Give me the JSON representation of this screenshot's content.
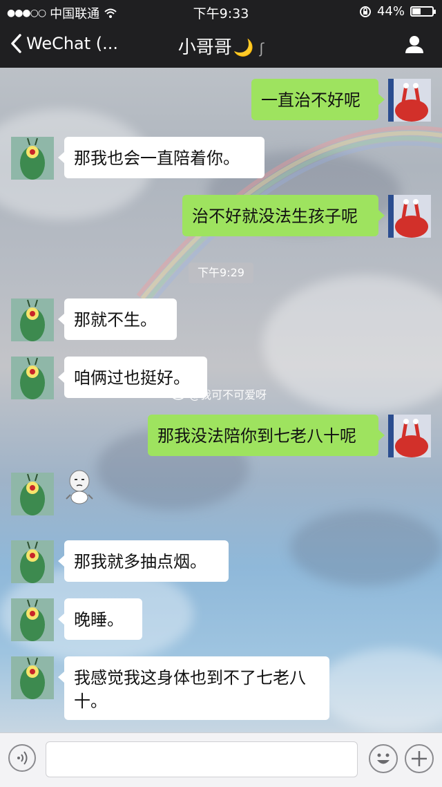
{
  "status_bar": {
    "carrier": "中国联通",
    "time": "下午9:33",
    "battery": "44%",
    "battery_level": 0.44
  },
  "nav": {
    "back_label": "WeChat (...",
    "title": "小哥哥",
    "title_emoji": "🌙",
    "icons": [
      "back-chevron-icon",
      "moon-icon",
      "earpiece-icon",
      "profile-icon"
    ]
  },
  "chat": {
    "timestamp": "下午9:29",
    "watermark": "@我可不可爱呀",
    "messages": [
      {
        "side": "out",
        "text": "一直治不好呢"
      },
      {
        "side": "in",
        "text": "那我也会一直陪着你。"
      },
      {
        "side": "out",
        "text": "治不好就没法生孩子呢"
      },
      {
        "side": "in",
        "text": "那就不生。"
      },
      {
        "side": "in",
        "text": "咱俩过也挺好。"
      },
      {
        "side": "out",
        "text": "那我没法陪你到七老八十呢"
      },
      {
        "side": "in",
        "text": "",
        "type": "sticker"
      },
      {
        "side": "in",
        "text": "那我就多抽点烟。"
      },
      {
        "side": "in",
        "text": "晚睡。"
      },
      {
        "side": "in",
        "text": "我感觉我这身体也到不了七老八十。"
      }
    ]
  },
  "input_bar": {
    "icons": [
      "voice-icon",
      "emoji-icon",
      "plus-icon"
    ]
  },
  "colors": {
    "bar_bg": "#1f1f21",
    "outgoing_bubble": "#9ee35f",
    "incoming_bubble": "#ffffff"
  }
}
